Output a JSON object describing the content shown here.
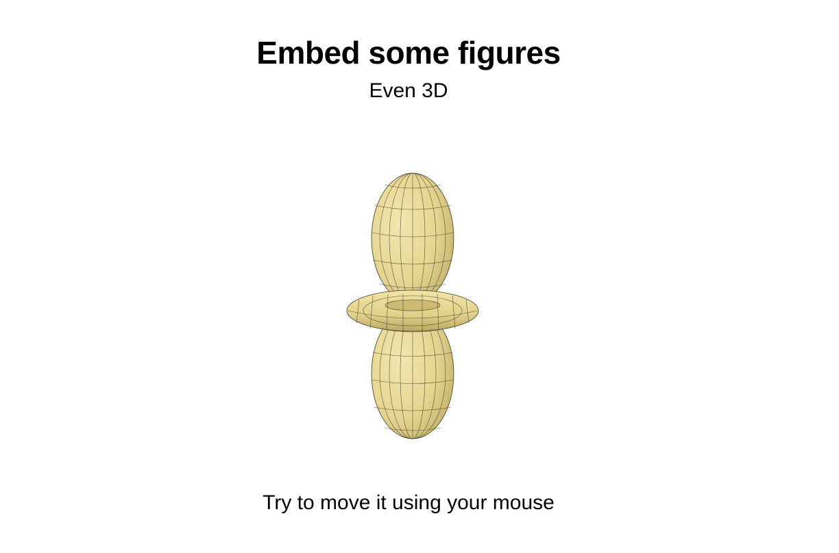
{
  "slide": {
    "title": "Embed some figures",
    "subtitle": "Even 3D",
    "caption": "Try to move it using your mouse"
  },
  "figure": {
    "kind": "3d-surface-plot",
    "surface_color": "#e8d894",
    "wire_color": "#3a3a2a",
    "shape": "orbital-lobes-with-torus"
  }
}
